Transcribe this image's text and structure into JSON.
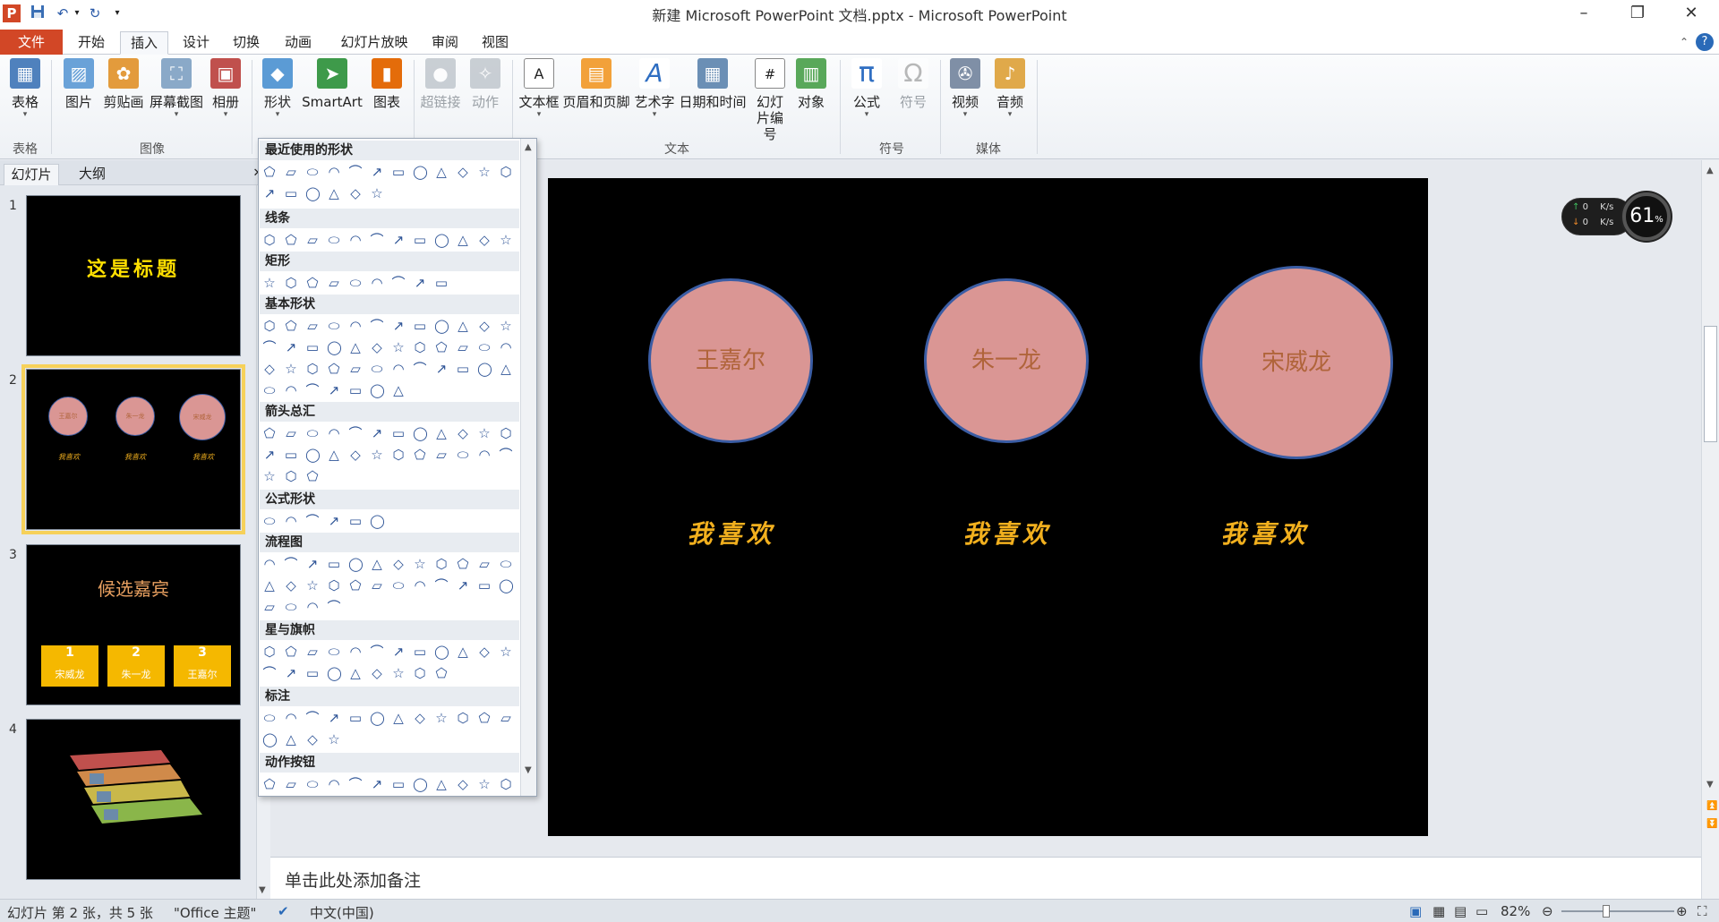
{
  "window": {
    "title": "新建 Microsoft PowerPoint 文档.pptx - Microsoft PowerPoint",
    "app_icon": "P"
  },
  "tabs": [
    {
      "label": "文件"
    },
    {
      "label": "开始"
    },
    {
      "label": "插入"
    },
    {
      "label": "设计"
    },
    {
      "label": "切换"
    },
    {
      "label": "动画"
    },
    {
      "label": "幻灯片放映"
    },
    {
      "label": "审阅"
    },
    {
      "label": "视图"
    }
  ],
  "ribbon": {
    "buttons": {
      "table": "表格",
      "picture": "图片",
      "clipart": "剪贴画",
      "screenshot": "屏幕截图",
      "album": "相册",
      "shapes": "形状",
      "smartart": "SmartArt",
      "chart": "图表",
      "hyperlink": "超链接",
      "action": "动作",
      "textbox": "文本框",
      "header_footer": "页眉和页脚",
      "wordart": "艺术字",
      "datetime": "日期和时间",
      "slide_number": "幻灯\n片编号",
      "object": "对象",
      "equation": "公式",
      "symbol": "符号",
      "video": "视频",
      "audio": "音频"
    },
    "groups": {
      "tables": "表格",
      "images": "图像",
      "text": "文本",
      "symbols": "符号",
      "media": "媒体"
    }
  },
  "panel_tabs": {
    "slides": "幻灯片",
    "outline": "大纲"
  },
  "slides": {
    "numbers": [
      "1",
      "2",
      "3",
      "4"
    ],
    "thumb1_title": "这是标题",
    "thumb2_names": [
      "王嘉尔",
      "朱一龙",
      "宋威龙"
    ],
    "thumb2_caption": "我喜欢",
    "thumb3_title": "候选嘉宾",
    "thumb3_podium": [
      {
        "num": "1",
        "name": "宋威龙"
      },
      {
        "num": "2",
        "name": "朱一龙"
      },
      {
        "num": "3",
        "name": "王嘉尔"
      }
    ]
  },
  "gallery": {
    "categories": {
      "recent": "最近使用的形状",
      "lines": "线条",
      "rect": "矩形",
      "basic": "基本形状",
      "arrows": "箭头总汇",
      "equation": "公式形状",
      "flowchart": "流程图",
      "stars": "星与旗帜",
      "callouts": "标注",
      "action": "动作按钮"
    }
  },
  "slide": {
    "circles": [
      "王嘉尔",
      "朱一龙",
      "宋威龙"
    ],
    "captions": [
      "我喜欢",
      "我喜欢",
      "我喜欢"
    ],
    "circle_fill": "#da9694",
    "circle_border": "#3b5da4",
    "caption_color": "#f2b01e"
  },
  "net_widget": {
    "up": "0",
    "down": "0",
    "unit": "K/s",
    "percent": "61",
    "percent_sign": "%"
  },
  "notes_placeholder": "单击此处添加备注",
  "status": {
    "slide_info": "幻灯片 第 2 张，共 5 张",
    "theme": "\"Office 主题\"",
    "language": "中文(中国)",
    "zoom": "82%"
  }
}
